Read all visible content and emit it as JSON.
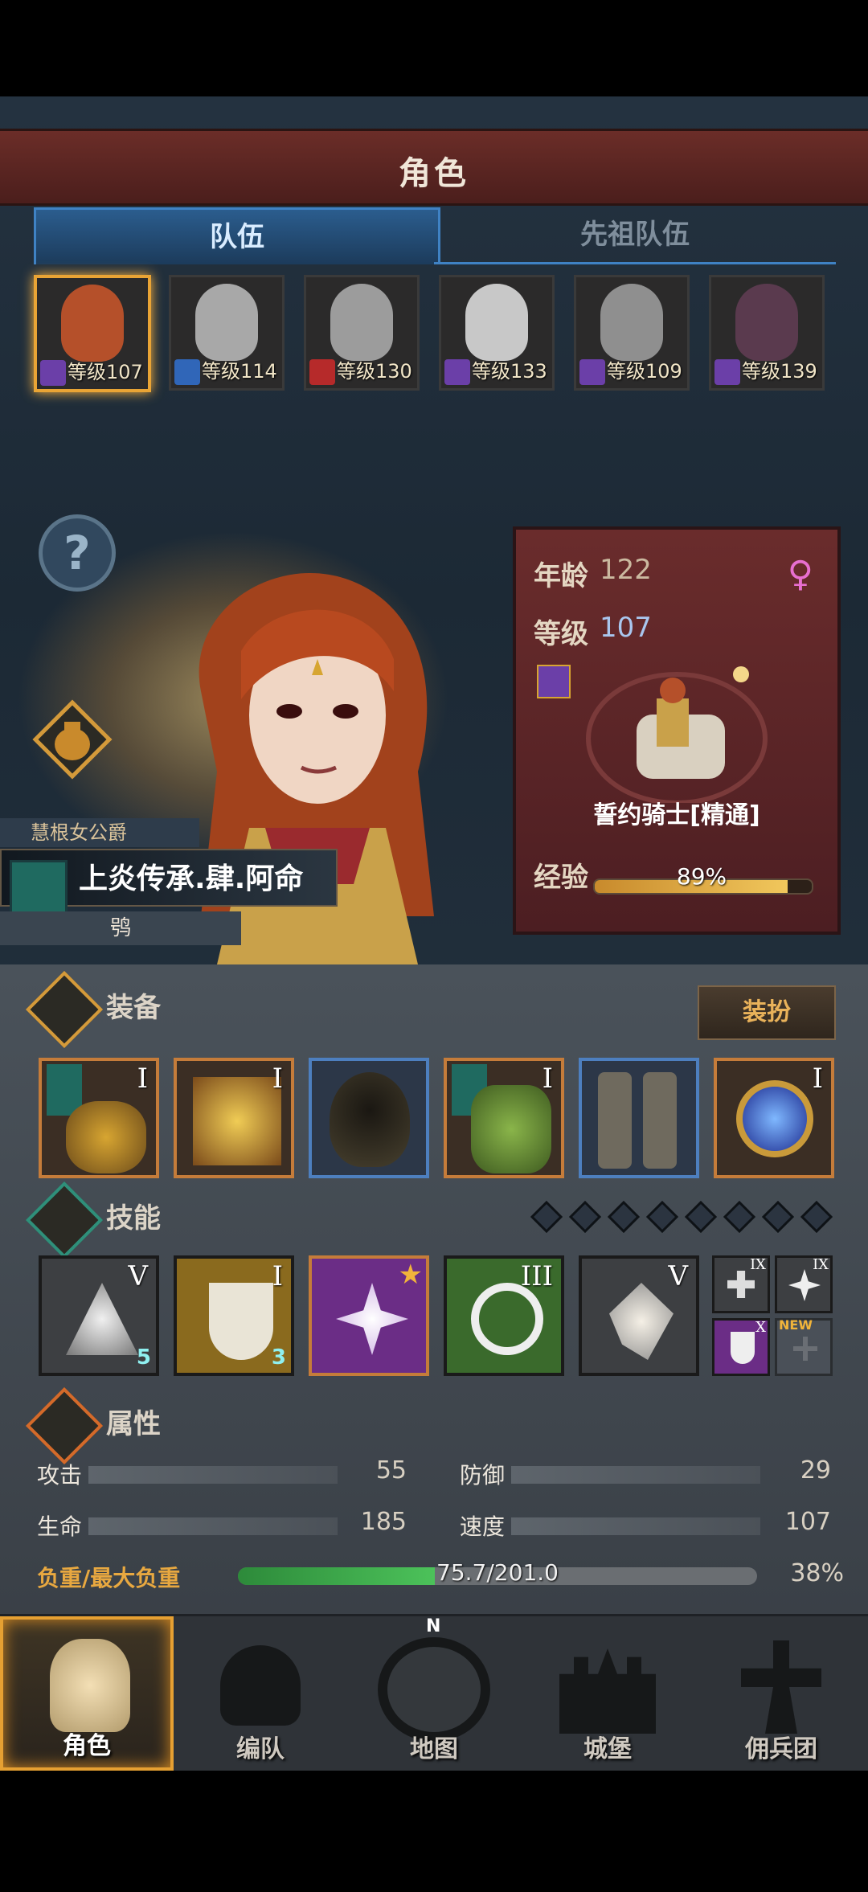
{
  "header": {
    "title": "角色"
  },
  "tabs": [
    {
      "label": "队伍"
    },
    {
      "label": "先祖队伍"
    }
  ],
  "team": [
    {
      "level_text": "等级107",
      "class_color": "#6b3fa8",
      "selected": true
    },
    {
      "level_text": "等级114",
      "class_color": "#3066b8",
      "selected": false
    },
    {
      "level_text": "等级130",
      "class_color": "#b62a2a",
      "selected": false
    },
    {
      "level_text": "等级133",
      "class_color": "#6b3fa8",
      "selected": false
    },
    {
      "level_text": "等级109",
      "class_color": "#6b3fa8",
      "selected": false
    },
    {
      "level_text": "等级139",
      "class_color": "#6b3fa8",
      "selected": false
    }
  ],
  "character": {
    "title": "慧根女公爵",
    "name": "上炎传承.肆.阿命",
    "subtitle": "鸮",
    "age_label": "年龄",
    "age": "122",
    "level_label": "等级",
    "level": "107",
    "class_name": "誓约骑士[精通]",
    "xp_label": "经验",
    "xp_text": "89%",
    "xp_fraction": 0.89,
    "gender_icon": "female-icon"
  },
  "equipment": {
    "title": "装备",
    "dress_button": "装扮",
    "slots": [
      {
        "icon": "dragon-weapon-icon",
        "rank": "I",
        "banner": true,
        "rarity": "orange"
      },
      {
        "icon": "golden-tome-icon",
        "rank": "I",
        "banner": false,
        "rarity": "orange"
      },
      {
        "icon": "hooded-cloak-icon",
        "rank": "",
        "banner": false,
        "rarity": "blue"
      },
      {
        "icon": "leaf-armor-icon",
        "rank": "I",
        "banner": true,
        "rarity": "orange"
      },
      {
        "icon": "boots-icon",
        "rank": "",
        "banner": false,
        "rarity": "blue"
      },
      {
        "icon": "orb-artifact-icon",
        "rank": "I",
        "banner": false,
        "rarity": "orange"
      }
    ]
  },
  "skills": {
    "title": "技能",
    "points": 8,
    "list": [
      {
        "icon": "spear-strike-icon",
        "rank": "V",
        "count": "5",
        "bg": "#3d3f42"
      },
      {
        "icon": "holy-shield-heal-icon",
        "rank": "I",
        "count": "3",
        "bg": "#8a6a1e"
      },
      {
        "icon": "shatter-strike-icon",
        "rank": "",
        "count": "",
        "bg": "#6b2d86"
      },
      {
        "icon": "target-crystal-icon",
        "rank": "III",
        "count": "",
        "bg": "#3a6a2c"
      },
      {
        "icon": "crystal-hand-icon",
        "rank": "V",
        "count": "",
        "bg": "#3d3f42"
      }
    ],
    "mini": [
      {
        "icon": "cross-heal-icon",
        "rank": "IX"
      },
      {
        "icon": "burst-icon",
        "rank": "IX"
      },
      {
        "icon": "shield-icon",
        "rank": "X"
      },
      {
        "icon": "locked-slot-icon",
        "rank": "NEW"
      }
    ]
  },
  "attributes": {
    "title": "属性",
    "attack_label": "攻击",
    "attack": "55",
    "defense_label": "防御",
    "defense": "29",
    "hp_label": "生命",
    "hp": "185",
    "speed_label": "速度",
    "speed": "107",
    "load_label": "负重/最大负重",
    "load_text": "75.7/201.0",
    "load_fraction": 0.38,
    "load_percent": "38%"
  },
  "nav": [
    {
      "label": "角色",
      "icon": "knight-icon",
      "active": true
    },
    {
      "label": "编队",
      "icon": "helmet-icon",
      "active": false
    },
    {
      "label": "地图",
      "icon": "compass-icon",
      "active": false
    },
    {
      "label": "城堡",
      "icon": "castle-icon",
      "active": false
    },
    {
      "label": "佣兵团",
      "icon": "mercenary-icon",
      "active": false
    }
  ],
  "nav_compass_letter": "N"
}
